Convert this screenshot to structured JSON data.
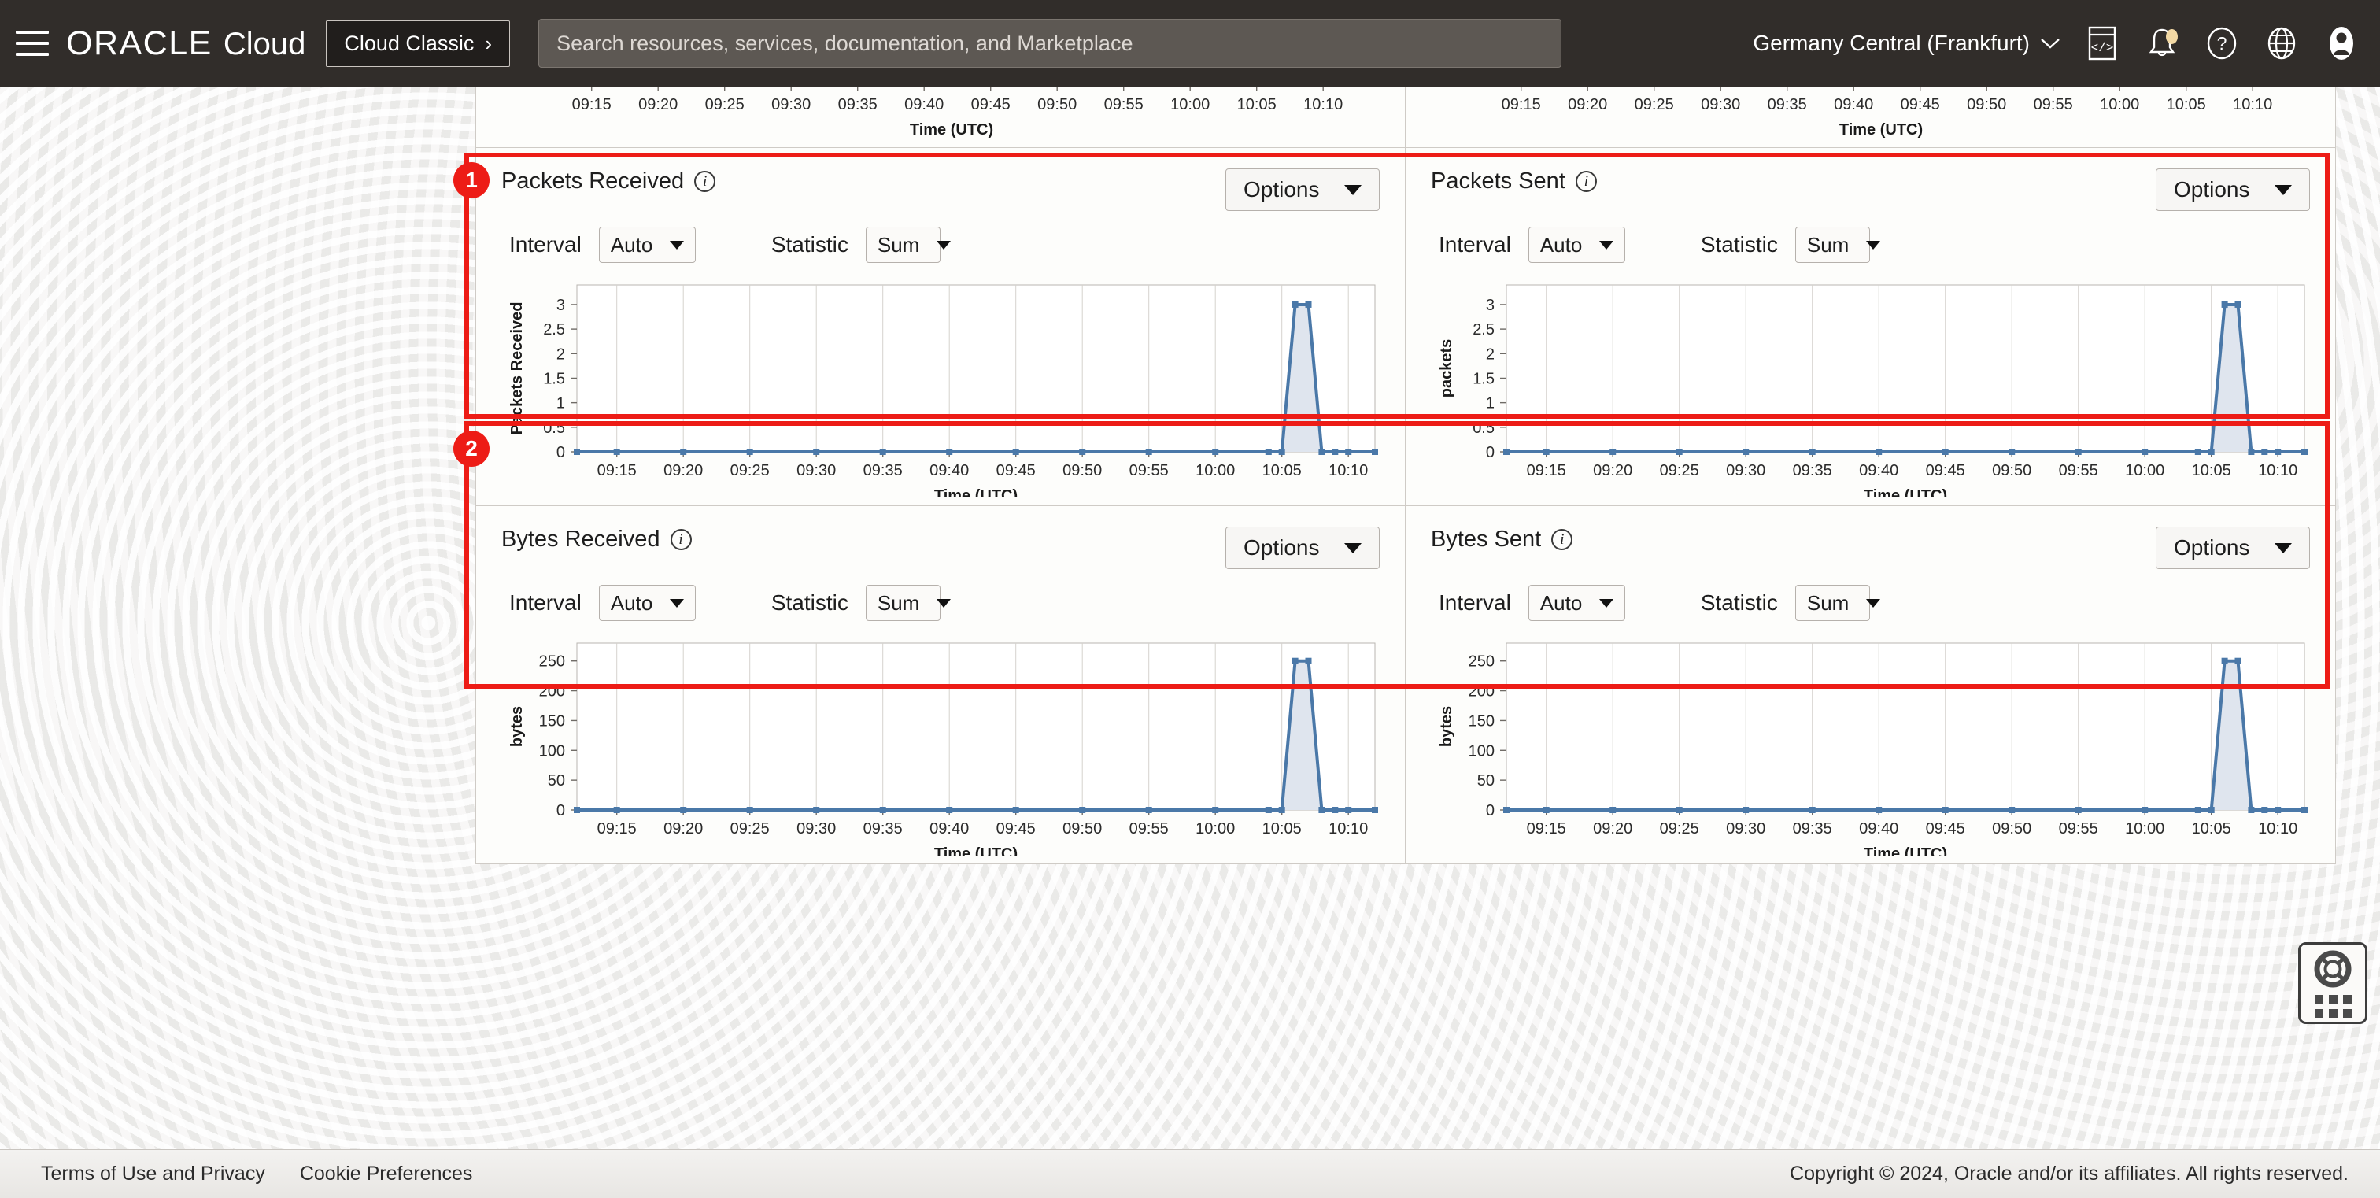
{
  "header": {
    "menu_icon": "hamburger-icon",
    "brand_oracle": "ORACLE",
    "brand_cloud": "Cloud",
    "cloud_classic_label": "Cloud Classic",
    "cloud_classic_chevron": "›",
    "search_placeholder": "Search resources, services, documentation, and Marketplace",
    "search_value": "",
    "region": "Germany Central (Frankfurt)",
    "region_chevron": "∨",
    "icons": [
      "cloud-shell-icon",
      "notifications-bell-icon",
      "help-question-icon",
      "language-globe-icon",
      "user-avatar-icon"
    ]
  },
  "annotations": [
    {
      "number": "1",
      "target": "packets-row"
    },
    {
      "number": "2",
      "target": "bytes-row"
    }
  ],
  "controls": {
    "interval_label": "Interval",
    "interval_value": "Auto",
    "statistic_label": "Statistic",
    "statistic_value": "Sum",
    "options_label": "Options"
  },
  "panels": [
    {
      "id": "packets-received",
      "title": "Packets Received",
      "clipped": false
    },
    {
      "id": "packets-sent",
      "title": "Packets Sent",
      "clipped": false
    },
    {
      "id": "bytes-received",
      "title": "Bytes Received",
      "clipped": false
    },
    {
      "id": "bytes-sent",
      "title": "Bytes Sent",
      "clipped": false
    }
  ],
  "chart_data": [
    {
      "id": "packets-received",
      "type": "area",
      "title": "Packets Received",
      "xlabel": "Time (UTC)",
      "ylabel": "Packets Received",
      "ylim": [
        0,
        3.4
      ],
      "yticks": [
        0,
        0.5,
        1,
        1.5,
        2,
        2.5,
        3
      ],
      "ytick_labels": [
        "0",
        "0.5",
        "1",
        "1.5",
        "2",
        "2.5",
        "3"
      ],
      "xticks": [
        "09:15",
        "09:20",
        "09:25",
        "09:30",
        "09:35",
        "09:40",
        "09:45",
        "09:50",
        "09:55",
        "10:00",
        "10:05",
        "10:10"
      ],
      "grid": true,
      "series": [
        {
          "name": "Packets Received",
          "x": [
            "09:12",
            "09:15",
            "09:20",
            "09:25",
            "09:30",
            "09:35",
            "09:40",
            "09:45",
            "09:50",
            "09:55",
            "10:00",
            "10:04",
            "10:05",
            "10:06",
            "10:07",
            "10:08",
            "10:09",
            "10:10",
            "10:12"
          ],
          "values": [
            0,
            0,
            0,
            0,
            0,
            0,
            0,
            0,
            0,
            0,
            0,
            0,
            0,
            3,
            3,
            0,
            0,
            0,
            0
          ]
        }
      ]
    },
    {
      "id": "packets-sent",
      "type": "area",
      "title": "Packets Sent",
      "xlabel": "Time (UTC)",
      "ylabel": "packets",
      "ylim": [
        0,
        3.4
      ],
      "yticks": [
        0,
        0.5,
        1,
        1.5,
        2,
        2.5,
        3
      ],
      "ytick_labels": [
        "0",
        "0.5",
        "1",
        "1.5",
        "2",
        "2.5",
        "3"
      ],
      "xticks": [
        "09:15",
        "09:20",
        "09:25",
        "09:30",
        "09:35",
        "09:40",
        "09:45",
        "09:50",
        "09:55",
        "10:00",
        "10:05",
        "10:10"
      ],
      "grid": true,
      "series": [
        {
          "name": "Packets Sent",
          "x": [
            "09:12",
            "09:15",
            "09:20",
            "09:25",
            "09:30",
            "09:35",
            "09:40",
            "09:45",
            "09:50",
            "09:55",
            "10:00",
            "10:04",
            "10:05",
            "10:06",
            "10:07",
            "10:08",
            "10:09",
            "10:10",
            "10:12"
          ],
          "values": [
            0,
            0,
            0,
            0,
            0,
            0,
            0,
            0,
            0,
            0,
            0,
            0,
            0,
            3,
            3,
            0,
            0,
            0,
            0
          ]
        }
      ]
    },
    {
      "id": "bytes-received",
      "type": "area",
      "title": "Bytes Received",
      "xlabel": "Time (UTC)",
      "ylabel": "bytes",
      "ylim": [
        0,
        280
      ],
      "yticks": [
        0,
        50,
        100,
        150,
        200,
        250
      ],
      "ytick_labels": [
        "0",
        "50",
        "100",
        "150",
        "200",
        "250"
      ],
      "xticks": [
        "09:15",
        "09:20",
        "09:25",
        "09:30",
        "09:35",
        "09:40",
        "09:45",
        "09:50",
        "09:55",
        "10:00",
        "10:05",
        "10:10"
      ],
      "grid": true,
      "series": [
        {
          "name": "Bytes Received",
          "x": [
            "09:12",
            "09:15",
            "09:20",
            "09:25",
            "09:30",
            "09:35",
            "09:40",
            "09:45",
            "09:50",
            "09:55",
            "10:00",
            "10:04",
            "10:05",
            "10:06",
            "10:07",
            "10:08",
            "10:09",
            "10:10",
            "10:12"
          ],
          "values": [
            0,
            0,
            0,
            0,
            0,
            0,
            0,
            0,
            0,
            0,
            0,
            0,
            0,
            250,
            250,
            0,
            0,
            0,
            0
          ]
        }
      ]
    },
    {
      "id": "bytes-sent",
      "type": "area",
      "title": "Bytes Sent",
      "xlabel": "Time (UTC)",
      "ylabel": "bytes",
      "ylim": [
        0,
        280
      ],
      "yticks": [
        0,
        50,
        100,
        150,
        200,
        250
      ],
      "ytick_labels": [
        "0",
        "50",
        "100",
        "150",
        "200",
        "250"
      ],
      "xticks": [
        "09:15",
        "09:20",
        "09:25",
        "09:30",
        "09:35",
        "09:40",
        "09:45",
        "09:50",
        "09:55",
        "10:00",
        "10:05",
        "10:10"
      ],
      "grid": true,
      "series": [
        {
          "name": "Bytes Sent",
          "x": [
            "09:12",
            "09:15",
            "09:20",
            "09:25",
            "09:30",
            "09:35",
            "09:40",
            "09:45",
            "09:50",
            "09:55",
            "10:00",
            "10:04",
            "10:05",
            "10:06",
            "10:07",
            "10:08",
            "10:09",
            "10:10",
            "10:12"
          ],
          "values": [
            0,
            0,
            0,
            0,
            0,
            0,
            0,
            0,
            0,
            0,
            0,
            0,
            0,
            250,
            250,
            0,
            0,
            0,
            0
          ]
        }
      ]
    }
  ],
  "clipped_row": {
    "xlabel": "Time (UTC)",
    "xticks": [
      "09:15",
      "09:20",
      "09:25",
      "09:30",
      "09:35",
      "09:40",
      "09:45",
      "09:50",
      "09:55",
      "10:00",
      "10:05",
      "10:10"
    ]
  },
  "help_widget": {
    "icon": "lifebuoy-icon",
    "grid_icon": "app-grid-icon"
  },
  "footer": {
    "terms_label": "Terms of Use and Privacy",
    "cookies_label": "Cookie Preferences",
    "copyright": "Copyright © 2024, Oracle and/or its affiliates. All rights reserved."
  },
  "colors": {
    "nav_bg": "#312d2a",
    "accent_red": "#ed1c16",
    "series_line": "#4a78a8",
    "series_fill": "#dfe5ee",
    "page_bg": "#f0efed"
  }
}
